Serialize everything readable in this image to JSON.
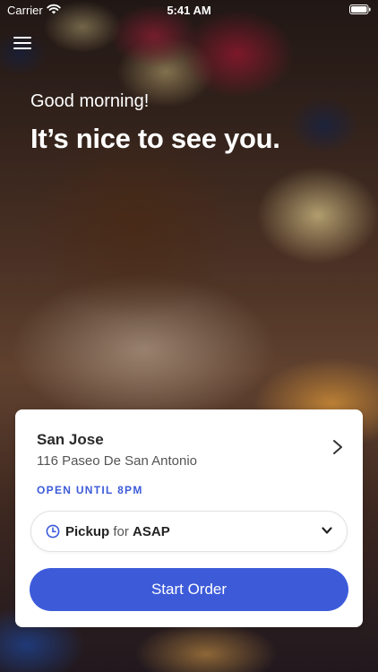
{
  "status_bar": {
    "carrier": "Carrier",
    "time": "5:41 AM"
  },
  "icons": {
    "menu": "hamburger-menu-icon",
    "wifi": "wifi-icon",
    "battery": "battery-icon",
    "chevron": "chevron-right-icon",
    "clock": "clock-icon",
    "dropdown": "chevron-down-icon"
  },
  "hero": {
    "greeting": "Good morning!",
    "headline": "It’s nice to see you."
  },
  "location": {
    "name": "San Jose",
    "address": "116 Paseo De San Antonio",
    "hours": "OPEN UNTIL 8PM"
  },
  "order_mode": {
    "mode": "Pickup",
    "connector": "for",
    "time": "ASAP"
  },
  "actions": {
    "start_order": "Start Order"
  },
  "colors": {
    "accent": "#3d5bd9",
    "card": "#ffffff",
    "text_primary": "#2a2a2a"
  }
}
